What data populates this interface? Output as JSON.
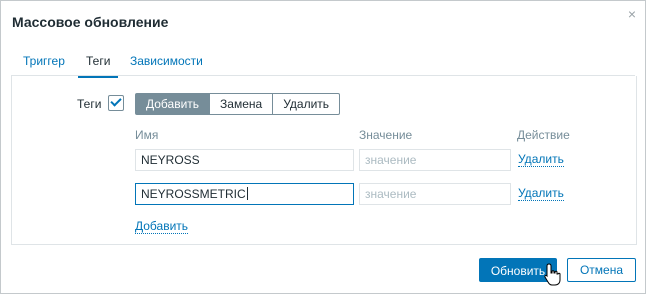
{
  "dialog": {
    "title": "Массовое обновление",
    "close_icon": "×"
  },
  "tabs": [
    {
      "label": "Триггер",
      "active": false
    },
    {
      "label": "Теги",
      "active": true
    },
    {
      "label": "Зависимости",
      "active": false
    }
  ],
  "tags_section": {
    "label": "Теги",
    "checkbox_checked": true,
    "modes": [
      {
        "label": "Добавить",
        "active": true
      },
      {
        "label": "Замена",
        "active": false
      },
      {
        "label": "Удалить",
        "active": false
      }
    ],
    "columns": {
      "name": "Имя",
      "value": "Значение",
      "action": "Действие"
    },
    "rows": [
      {
        "name": "NEYROSS",
        "value_placeholder": "значение",
        "action": "Удалить"
      },
      {
        "name": "NEYROSSMETRIC",
        "value_placeholder": "значение",
        "action": "Удалить"
      }
    ],
    "add_link": "Добавить"
  },
  "footer": {
    "update_label": "Обновить",
    "cancel_label": "Отмена"
  },
  "colors": {
    "accent": "#0275b8",
    "segment_active": "#768d99",
    "text": "#1f2c33"
  }
}
